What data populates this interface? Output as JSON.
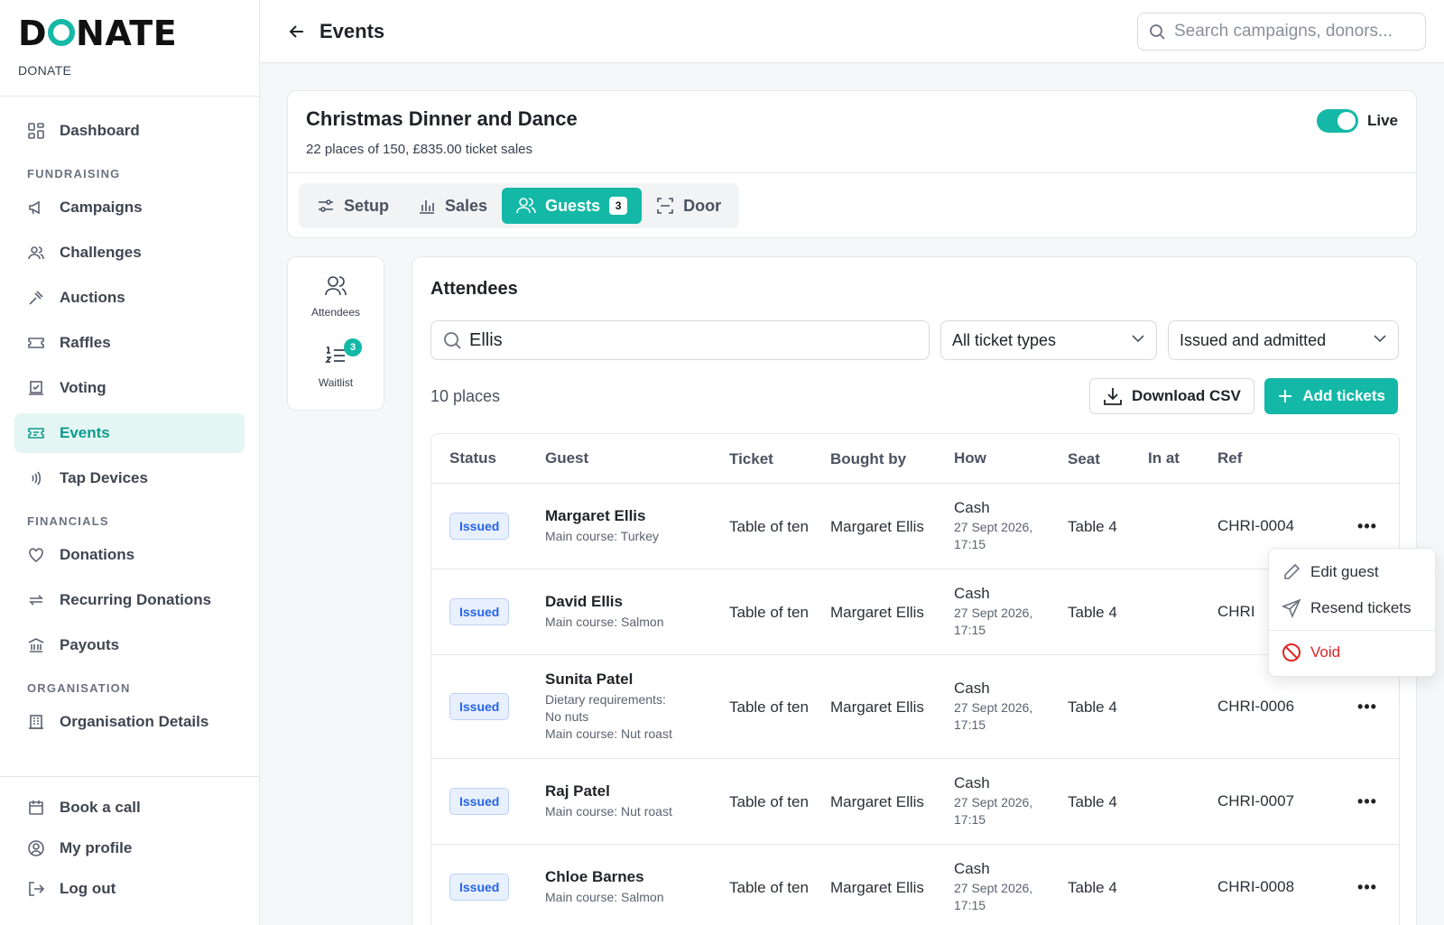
{
  "brand": {
    "logo": "DONATE",
    "org": "DONATE"
  },
  "sidebar": {
    "dashboard": "Dashboard",
    "sections": {
      "fundraising": "FUNDRAISING",
      "financials": "FINANCIALS",
      "organisation": "ORGANISATION"
    },
    "fundraising_items": [
      "Campaigns",
      "Challenges",
      "Auctions",
      "Raffles",
      "Voting",
      "Events",
      "Tap Devices"
    ],
    "financial_items": [
      "Donations",
      "Recurring Donations",
      "Payouts"
    ],
    "organisation_items": [
      "Organisation Details"
    ],
    "bottom_items": [
      "Book a call",
      "My profile",
      "Log out"
    ],
    "active": "Events"
  },
  "topbar": {
    "title": "Events",
    "search_placeholder": "Search campaigns, donors..."
  },
  "event": {
    "title": "Christmas Dinner and Dance",
    "subtitle": "22 places of 150, £835.00 ticket sales",
    "live_label": "Live",
    "live": true,
    "tabs": [
      {
        "label": "Setup"
      },
      {
        "label": "Sales"
      },
      {
        "label": "Guests",
        "count": "3"
      },
      {
        "label": "Door"
      }
    ],
    "active_tab": "Guests"
  },
  "mini_nav": {
    "attendees": "Attendees",
    "waitlist": "Waitlist",
    "waitlist_count": "3"
  },
  "attendees": {
    "title": "Attendees",
    "search_value": "Ellis",
    "ticket_filter": "All ticket types",
    "status_filter": "Issued and admitted",
    "places": "10 places",
    "download_label": "Download CSV",
    "add_label": "Add tickets",
    "columns": [
      "Status",
      "Guest",
      "Ticket",
      "Bought by",
      "How",
      "Seat",
      "In at",
      "Ref"
    ],
    "rows": [
      {
        "status": "Issued",
        "name": "Margaret Ellis",
        "notes": [
          "Main course: Turkey"
        ],
        "ticket": "Table of ten",
        "bought_by": "Margaret Ellis",
        "how": "Cash",
        "date": "27 Sept 2026, 17:15",
        "seat": "Table 4",
        "in_at": "",
        "ref": "CHRI-0004"
      },
      {
        "status": "Issued",
        "name": "David Ellis",
        "notes": [
          "Main course: Salmon"
        ],
        "ticket": "Table of ten",
        "bought_by": "Margaret Ellis",
        "how": "Cash",
        "date": "27 Sept 2026, 17:15",
        "seat": "Table 4",
        "in_at": "",
        "ref": "CHRI"
      },
      {
        "status": "Issued",
        "name": "Sunita Patel",
        "notes": [
          "Dietary requirements:",
          "No nuts",
          "Main course: Nut roast"
        ],
        "ticket": "Table of ten",
        "bought_by": "Margaret Ellis",
        "how": "Cash",
        "date": "27 Sept 2026, 17:15",
        "seat": "Table 4",
        "in_at": "",
        "ref": "CHRI-0006"
      },
      {
        "status": "Issued",
        "name": "Raj Patel",
        "notes": [
          "Main course: Nut roast"
        ],
        "ticket": "Table of ten",
        "bought_by": "Margaret Ellis",
        "how": "Cash",
        "date": "27 Sept 2026, 17:15",
        "seat": "Table 4",
        "in_at": "",
        "ref": "CHRI-0007"
      },
      {
        "status": "Issued",
        "name": "Chloe Barnes",
        "notes": [
          "Main course: Salmon"
        ],
        "ticket": "Table of ten",
        "bought_by": "Margaret Ellis",
        "how": "Cash",
        "date": "27 Sept 2026, 17:15",
        "seat": "Table 4",
        "in_at": "",
        "ref": "CHRI-0008"
      }
    ]
  },
  "row_menu": {
    "edit": "Edit guest",
    "resend": "Resend tickets",
    "void": "Void"
  },
  "colors": {
    "accent": "#14b8a6",
    "active_bg": "#e3f6f3",
    "badge_blue": "#2563eb",
    "danger": "#dc2626"
  }
}
